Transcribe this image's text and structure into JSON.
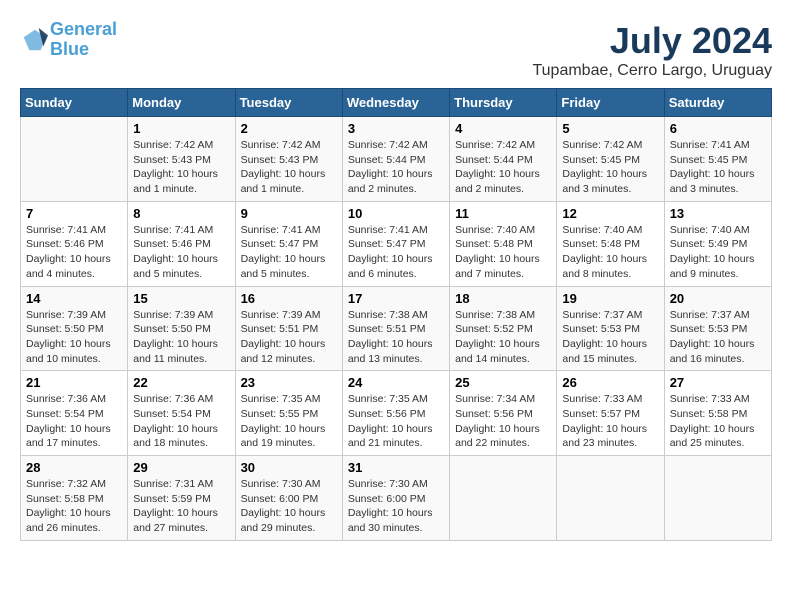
{
  "logo": {
    "line1": "General",
    "line2": "Blue"
  },
  "title": "July 2024",
  "subtitle": "Tupambae, Cerro Largo, Uruguay",
  "days_of_week": [
    "Sunday",
    "Monday",
    "Tuesday",
    "Wednesday",
    "Thursday",
    "Friday",
    "Saturday"
  ],
  "weeks": [
    [
      {
        "day": "",
        "info": ""
      },
      {
        "day": "1",
        "info": "Sunrise: 7:42 AM\nSunset: 5:43 PM\nDaylight: 10 hours\nand 1 minute."
      },
      {
        "day": "2",
        "info": "Sunrise: 7:42 AM\nSunset: 5:43 PM\nDaylight: 10 hours\nand 1 minute."
      },
      {
        "day": "3",
        "info": "Sunrise: 7:42 AM\nSunset: 5:44 PM\nDaylight: 10 hours\nand 2 minutes."
      },
      {
        "day": "4",
        "info": "Sunrise: 7:42 AM\nSunset: 5:44 PM\nDaylight: 10 hours\nand 2 minutes."
      },
      {
        "day": "5",
        "info": "Sunrise: 7:42 AM\nSunset: 5:45 PM\nDaylight: 10 hours\nand 3 minutes."
      },
      {
        "day": "6",
        "info": "Sunrise: 7:41 AM\nSunset: 5:45 PM\nDaylight: 10 hours\nand 3 minutes."
      }
    ],
    [
      {
        "day": "7",
        "info": "Sunrise: 7:41 AM\nSunset: 5:46 PM\nDaylight: 10 hours\nand 4 minutes."
      },
      {
        "day": "8",
        "info": "Sunrise: 7:41 AM\nSunset: 5:46 PM\nDaylight: 10 hours\nand 5 minutes."
      },
      {
        "day": "9",
        "info": "Sunrise: 7:41 AM\nSunset: 5:47 PM\nDaylight: 10 hours\nand 5 minutes."
      },
      {
        "day": "10",
        "info": "Sunrise: 7:41 AM\nSunset: 5:47 PM\nDaylight: 10 hours\nand 6 minutes."
      },
      {
        "day": "11",
        "info": "Sunrise: 7:40 AM\nSunset: 5:48 PM\nDaylight: 10 hours\nand 7 minutes."
      },
      {
        "day": "12",
        "info": "Sunrise: 7:40 AM\nSunset: 5:48 PM\nDaylight: 10 hours\nand 8 minutes."
      },
      {
        "day": "13",
        "info": "Sunrise: 7:40 AM\nSunset: 5:49 PM\nDaylight: 10 hours\nand 9 minutes."
      }
    ],
    [
      {
        "day": "14",
        "info": "Sunrise: 7:39 AM\nSunset: 5:50 PM\nDaylight: 10 hours\nand 10 minutes."
      },
      {
        "day": "15",
        "info": "Sunrise: 7:39 AM\nSunset: 5:50 PM\nDaylight: 10 hours\nand 11 minutes."
      },
      {
        "day": "16",
        "info": "Sunrise: 7:39 AM\nSunset: 5:51 PM\nDaylight: 10 hours\nand 12 minutes."
      },
      {
        "day": "17",
        "info": "Sunrise: 7:38 AM\nSunset: 5:51 PM\nDaylight: 10 hours\nand 13 minutes."
      },
      {
        "day": "18",
        "info": "Sunrise: 7:38 AM\nSunset: 5:52 PM\nDaylight: 10 hours\nand 14 minutes."
      },
      {
        "day": "19",
        "info": "Sunrise: 7:37 AM\nSunset: 5:53 PM\nDaylight: 10 hours\nand 15 minutes."
      },
      {
        "day": "20",
        "info": "Sunrise: 7:37 AM\nSunset: 5:53 PM\nDaylight: 10 hours\nand 16 minutes."
      }
    ],
    [
      {
        "day": "21",
        "info": "Sunrise: 7:36 AM\nSunset: 5:54 PM\nDaylight: 10 hours\nand 17 minutes."
      },
      {
        "day": "22",
        "info": "Sunrise: 7:36 AM\nSunset: 5:54 PM\nDaylight: 10 hours\nand 18 minutes."
      },
      {
        "day": "23",
        "info": "Sunrise: 7:35 AM\nSunset: 5:55 PM\nDaylight: 10 hours\nand 19 minutes."
      },
      {
        "day": "24",
        "info": "Sunrise: 7:35 AM\nSunset: 5:56 PM\nDaylight: 10 hours\nand 21 minutes."
      },
      {
        "day": "25",
        "info": "Sunrise: 7:34 AM\nSunset: 5:56 PM\nDaylight: 10 hours\nand 22 minutes."
      },
      {
        "day": "26",
        "info": "Sunrise: 7:33 AM\nSunset: 5:57 PM\nDaylight: 10 hours\nand 23 minutes."
      },
      {
        "day": "27",
        "info": "Sunrise: 7:33 AM\nSunset: 5:58 PM\nDaylight: 10 hours\nand 25 minutes."
      }
    ],
    [
      {
        "day": "28",
        "info": "Sunrise: 7:32 AM\nSunset: 5:58 PM\nDaylight: 10 hours\nand 26 minutes."
      },
      {
        "day": "29",
        "info": "Sunrise: 7:31 AM\nSunset: 5:59 PM\nDaylight: 10 hours\nand 27 minutes."
      },
      {
        "day": "30",
        "info": "Sunrise: 7:30 AM\nSunset: 6:00 PM\nDaylight: 10 hours\nand 29 minutes."
      },
      {
        "day": "31",
        "info": "Sunrise: 7:30 AM\nSunset: 6:00 PM\nDaylight: 10 hours\nand 30 minutes."
      },
      {
        "day": "",
        "info": ""
      },
      {
        "day": "",
        "info": ""
      },
      {
        "day": "",
        "info": ""
      }
    ]
  ]
}
